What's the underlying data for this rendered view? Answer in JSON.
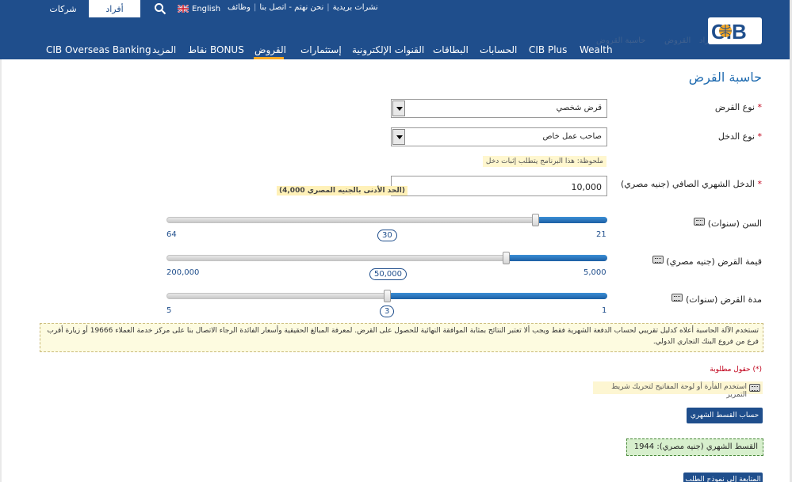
{
  "header": {
    "tabs": [
      {
        "label": "شركات"
      },
      {
        "label": "أفراد"
      }
    ],
    "language": "English",
    "util_links": [
      "وظائف",
      "نحن نهتم - اتصل بنا",
      "نشرات بريدية"
    ],
    "logo_text": "CIB",
    "nav": [
      "Wealth",
      "CIB Plus",
      "الحسابات",
      "البطاقات",
      "القنوات الإلكترونية",
      "إستثمارات",
      "القروض",
      "نقاط BONUS",
      "المزيد",
      "CIB Overseas Banking"
    ],
    "active_nav": "القروض",
    "breadcrumb": [
      "الرئيسية",
      "أفراد",
      "القروض",
      "حاسبة القروض"
    ]
  },
  "page": {
    "title": "حاسبة القرض",
    "loan_type": {
      "label": "نوع القرض",
      "value": "قرض شخصي"
    },
    "income_type": {
      "label": "نوع الدخل",
      "value": "صاحب عمل خاص"
    },
    "income_note": "ملحوظة: هذا البرنامج يتطلب إثبات دخل",
    "net_income": {
      "label": "الدخل الشهري الصافي (جنيه مصري)",
      "value": "10,000",
      "hint": "(الحد الأدنى بالجنيه المصري 4,000)"
    },
    "age": {
      "label": "السن (سنوات)",
      "min": "21",
      "max": "64",
      "value": "30",
      "position": 0.837
    },
    "loan_amount": {
      "label": "قيمة القرض (جنيه مصري)",
      "min": "5,000",
      "max": "200,000",
      "value": "50,000",
      "position": 0.77
    },
    "duration": {
      "label": "مدة القرض (سنوات)",
      "min": "1",
      "max": "5",
      "value": "3",
      "position": 0.5
    },
    "disclaimer": "تستخدم الآلة الحاسبة أعلاه كدليل تقريبي لحساب الدفعة الشهرية فقط ويجب ألا تعتبر النتائج بمثابة الموافقة النهائية للحصول على القرض. لمعرفة المبالغ الحقيقية وأسعار الفائدة الرجاء الاتصال بنا على مركز خدمة العملاء 19666 أو زيارة أقرب فرع من فروع البنك التجاري الدولي.",
    "required_note": "(*) حقول مطلوبة",
    "keyboard_note": "استخدم الفأرة أو لوحة المفاتيح لتحريك شريط التمرير",
    "calc_button": "حساب القسط الشهري",
    "result": "القسط الشهري (جنيه مصري): 1944",
    "next_button": "المتابعة إلى نموذج الطلب"
  },
  "colors": {
    "header_bg": "#1f4e8c",
    "accent": "#f7a823",
    "title": "#1f6bb0",
    "slider_fill": "#1c5fa4",
    "result_bg": "#d7efcd"
  },
  "icons": [
    "search-icon",
    "uk-flag-icon",
    "keyboard-icon",
    "select-arrow-icon"
  ]
}
